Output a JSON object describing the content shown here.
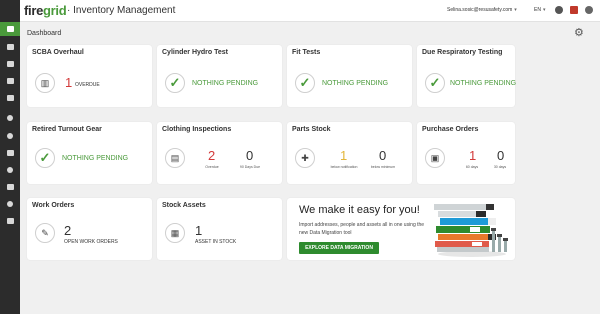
{
  "app": {
    "logo_prefix": "fire",
    "logo_suffix": "grid",
    "title": "Inventory Management"
  },
  "topbar": {
    "user_email": "Selina.sosic@resusafety.com",
    "language": "EN",
    "caret": "▾"
  },
  "page": {
    "title": "Dashboard"
  },
  "cards": {
    "scba": {
      "title": "SCBA Overhaul",
      "count": "1",
      "label": "OVERDUE"
    },
    "cylinder": {
      "title": "Cylinder Hydro Test",
      "status": "NOTHING PENDING"
    },
    "fit": {
      "title": "Fit Tests",
      "status": "NOTHING PENDING"
    },
    "respiratory": {
      "title": "Due Respiratory Testing",
      "status": "NOTHING PENDING"
    },
    "turnout": {
      "title": "Retired Turnout Gear",
      "status": "NOTHING PENDING"
    },
    "clothing": {
      "title": "Clothing Inspections",
      "count1": "2",
      "label1": "Overdue",
      "count2": "0",
      "label2": "90 Days Due"
    },
    "parts": {
      "title": "Parts Stock",
      "count1": "1",
      "label1": "below notification",
      "count2": "0",
      "label2": "below minimum"
    },
    "purchase": {
      "title": "Purchase Orders",
      "count1": "1",
      "label1": "60 days",
      "count2": "0",
      "label2": "30 days"
    },
    "work": {
      "title": "Work Orders",
      "count": "2",
      "label": "OPEN WORK ORDERS"
    },
    "stock": {
      "title": "Stock Assets",
      "count": "1",
      "label": "ASSET IN STOCK"
    }
  },
  "promo": {
    "title": "We make it easy for you!",
    "text": "Import addresses, people and assets all in one using the new Data Migration tool",
    "button": "EXPLORE DATA MIGRATION"
  },
  "colors": {
    "green": "#4a9a3b",
    "red": "#d33a3a",
    "yellow": "#e3b63a",
    "sidebar": "#2c2c2c",
    "button": "#2e8b2e"
  },
  "icons": {
    "sidebar": [
      "dashboard-icon",
      "inbox-icon",
      "folder-icon",
      "document-icon",
      "truck-icon",
      "lightbulb-icon",
      "user-icon",
      "gavel-icon",
      "location-icon",
      "list-icon",
      "settings-icon",
      "building-icon"
    ],
    "topbar": [
      "help-icon",
      "megaphone-icon",
      "avatar-icon"
    ]
  }
}
